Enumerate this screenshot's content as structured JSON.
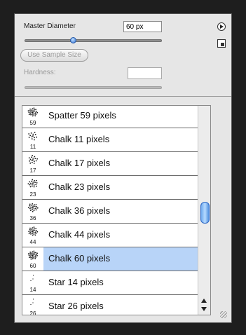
{
  "top": {
    "master_diameter_label": "Master Diameter",
    "master_diameter_value": "60 px",
    "master_diameter_slider_level": 0.35,
    "use_sample_size_label": "Use Sample Size",
    "hardness_label": "Hardness:",
    "hardness_value": ""
  },
  "brushes": [
    {
      "tip": "59",
      "name": "Spatter 59 pixels",
      "icon": "spatter-brush-icon",
      "selected": false
    },
    {
      "tip": "11",
      "name": "Chalk 11 pixels",
      "icon": "chalk-brush-icon",
      "selected": false
    },
    {
      "tip": "17",
      "name": "Chalk 17 pixels",
      "icon": "chalk-brush-icon",
      "selected": false
    },
    {
      "tip": "23",
      "name": "Chalk 23 pixels",
      "icon": "chalk-brush-icon",
      "selected": false
    },
    {
      "tip": "36",
      "name": "Chalk 36 pixels",
      "icon": "chalk-brush-icon",
      "selected": false
    },
    {
      "tip": "44",
      "name": "Chalk 44 pixels",
      "icon": "chalk-brush-icon",
      "selected": false
    },
    {
      "tip": "60",
      "name": "Chalk 60 pixels",
      "icon": "chalk-brush-icon",
      "selected": true
    },
    {
      "tip": "14",
      "name": "Star 14 pixels",
      "icon": "star-brush-icon",
      "selected": false
    },
    {
      "tip": "26",
      "name": "Star 26 pixels",
      "icon": "star-brush-icon",
      "selected": false
    }
  ],
  "colors": {
    "selected_row": "#b8d4f8",
    "accent": "#4a86d8"
  }
}
